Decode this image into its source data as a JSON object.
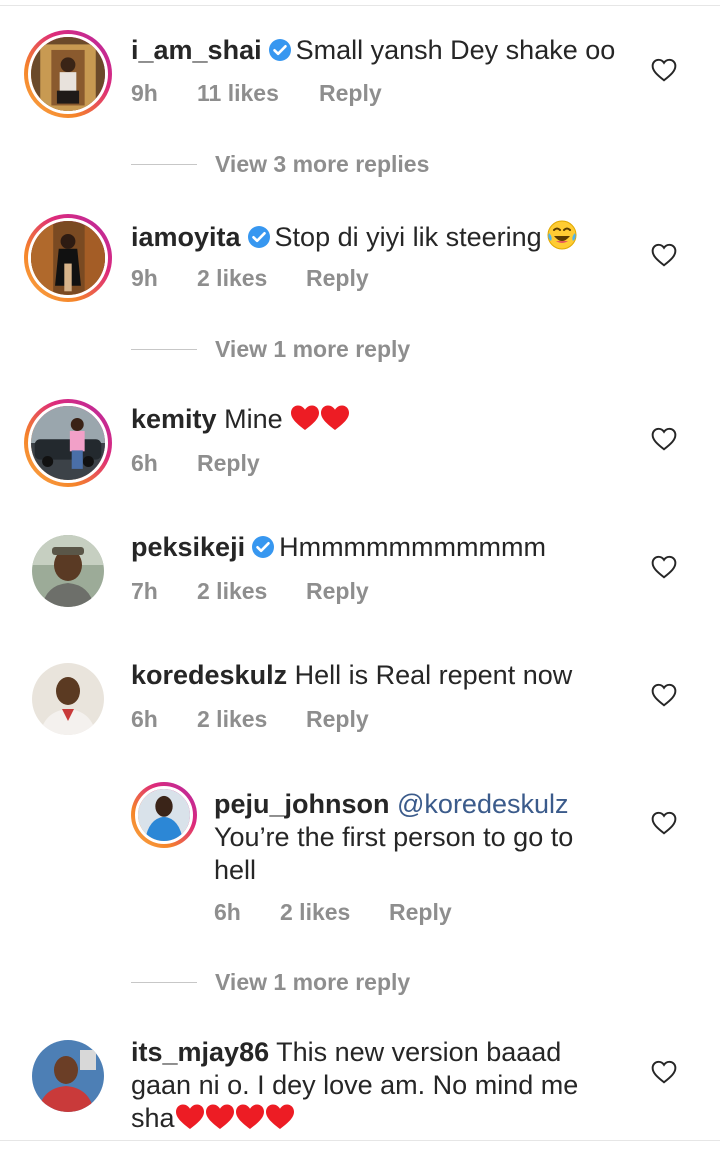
{
  "comments": [
    {
      "username": "i_am_shai",
      "verified": true,
      "text": "Small yansh Dey shake oo",
      "time": "9h",
      "likes": "11 likes",
      "reply": "Reply"
    },
    {
      "username": "iamoyita",
      "verified": true,
      "text": "Stop di yiyi lik steering",
      "emoji": "laughing-tears",
      "time": "9h",
      "likes": "2 likes",
      "reply": "Reply"
    },
    {
      "username": "kemity",
      "verified": false,
      "text": "Mine",
      "emoji": "red-heart x2",
      "time": "6h",
      "reply": "Reply"
    },
    {
      "username": "peksikeji",
      "verified": true,
      "text": "Hmmmmmmmmmmm",
      "time": "7h",
      "likes": "2 likes",
      "reply": "Reply"
    },
    {
      "username": "koredeskulz",
      "verified": false,
      "text": "Hell is Real repent now",
      "time": "6h",
      "likes": "2 likes",
      "reply": "Reply"
    },
    {
      "username": "peju_johnson",
      "verified": false,
      "mention": "@koredeskulz",
      "text_line1": "You’re the first person to go to",
      "text_line2": "hell",
      "time": "6h",
      "likes": "2 likes",
      "reply": "Reply"
    },
    {
      "username": "its_mjay86",
      "verified": false,
      "text_line1": "This new version baaad",
      "text_line2": "gaan ni o. I dey love am. No mind me",
      "text_line3": "sha",
      "emoji": "red-heart x4"
    }
  ],
  "view_more": [
    "View 3 more replies",
    "View 1 more reply",
    "View 1 more reply"
  ],
  "icons": {
    "like": "heart-outline-icon",
    "verified": "verified-badge-icon"
  },
  "colors": {
    "text": "#262626",
    "meta": "#8e8e8e",
    "verified": "#3797f0",
    "heart": "#ed4956",
    "mention": "#3b5b8b"
  }
}
